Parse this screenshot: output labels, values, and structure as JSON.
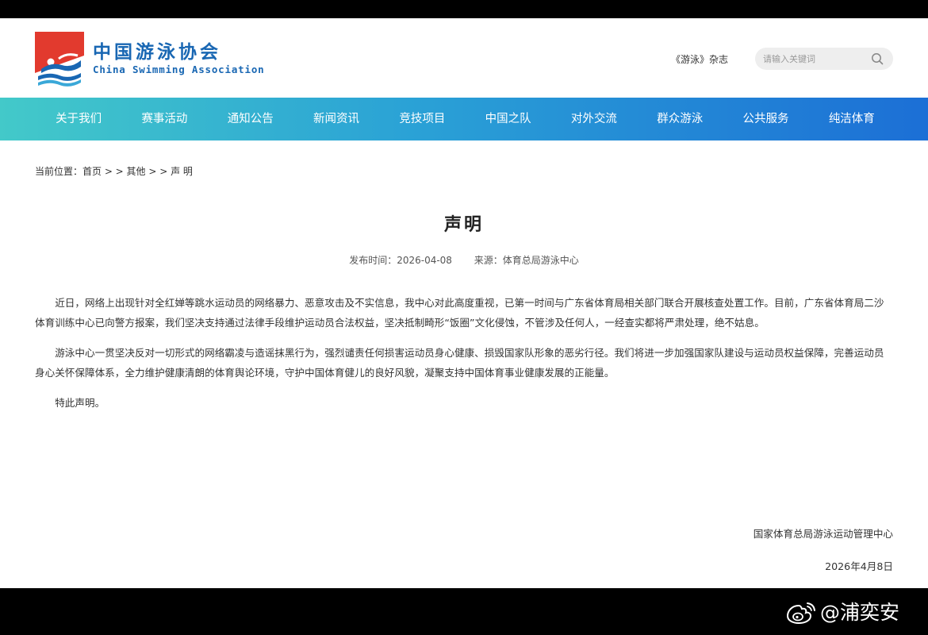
{
  "header": {
    "logo_cn": "中国游泳协会",
    "logo_en": "China Swimming Association",
    "magazine_link": "《游泳》杂志",
    "search_placeholder": "请输入关键词"
  },
  "nav": {
    "items": [
      {
        "label": "关于我们"
      },
      {
        "label": "赛事活动"
      },
      {
        "label": "通知公告"
      },
      {
        "label": "新闻资讯"
      },
      {
        "label": "竞技项目"
      },
      {
        "label": "中国之队"
      },
      {
        "label": "对外交流"
      },
      {
        "label": "群众游泳"
      },
      {
        "label": "公共服务"
      },
      {
        "label": "纯洁体育"
      }
    ]
  },
  "breadcrumb": {
    "text": "当前位置：首页 > > 其他 > > 声 明"
  },
  "article": {
    "title": "声明",
    "publish_time": "发布时间：2026-04-08",
    "source": "来源：体育总局游泳中心",
    "paragraphs": [
      "近日，网络上出现针对全红婵等跳水运动员的网络暴力、恶意攻击及不实信息，我中心对此高度重视，已第一时间与广东省体育局相关部门联合开展核查处置工作。目前，广东省体育局二沙体育训练中心已向警方报案，我们坚决支持通过法律手段维护运动员合法权益，坚决抵制畸形“饭圈”文化侵蚀，不管涉及任何人，一经查实都将严肃处理，绝不姑息。",
      "游泳中心一贯坚决反对一切形式的网络霸凌与造谣抹黑行为，强烈谴责任何损害运动员身心健康、损毁国家队形象的恶劣行径。我们将进一步加强国家队建设与运动员权益保障，完善运动员身心关怀保障体系，全力维护健康清朗的体育舆论环境，守护中国体育健儿的良好风貌，凝聚支持中国体育事业健康发展的正能量。",
      "特此声明。"
    ],
    "signature_org": "国家体育总局游泳运动管理中心",
    "signature_date": "2026年4月8日"
  },
  "watermark": {
    "text": "@浦奕安"
  },
  "colors": {
    "brand_blue": "#1967b3",
    "logo_red": "#e23a2e",
    "nav_gradient_start": "#43c9c9",
    "nav_gradient_end": "#1c6fd6"
  }
}
